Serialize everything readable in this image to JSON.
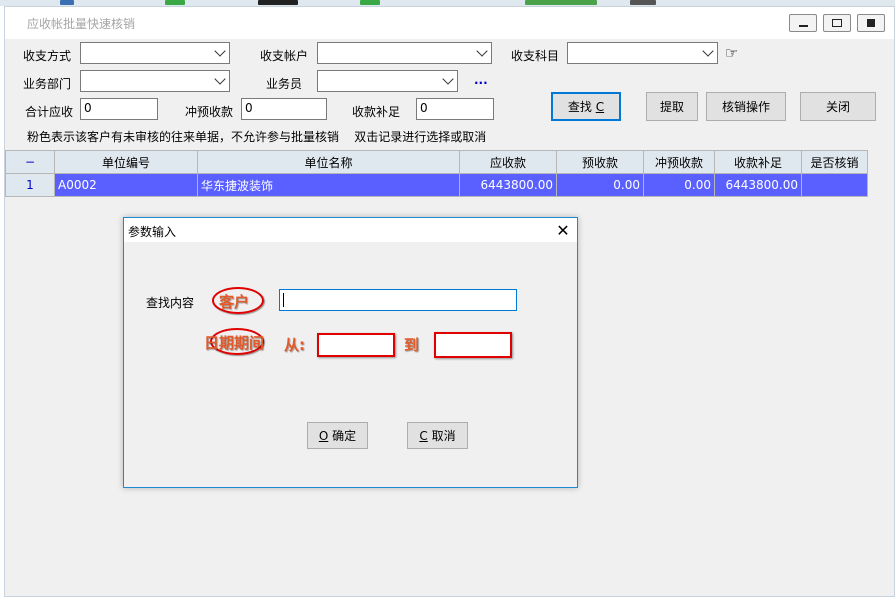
{
  "main_window": {
    "title": "应收帐批量快速核销",
    "filters": {
      "receipt_method_label": "收支方式",
      "receipt_account_label": "收支帐户",
      "receipt_subject_label": "收支科目",
      "department_label": "业务部门",
      "salesperson_label": "业务员",
      "ellipsis": "...",
      "pointer_glyph": "☞"
    },
    "totals": {
      "total_receivable_label": "合计应收",
      "total_receivable_value": "0",
      "offset_prepaid_label": "冲预收款",
      "offset_prepaid_value": "0",
      "receipt_supplement_label": "收款补足",
      "receipt_supplement_value": "0"
    },
    "buttons": {
      "find_label": "查找",
      "find_hotkey": "C",
      "extract_label": "提取",
      "writeoff_label": "核销操作",
      "close_label": "关闭"
    },
    "hint": "粉色表示该客户有未审核的往来单据，不允许参与批量核销    双击记录进行选择或取消",
    "grid": {
      "corner": "−",
      "columns": [
        "单位编号",
        "单位名称",
        "应收款",
        "预收款",
        "冲预收款",
        "收款补足",
        "是否核销"
      ],
      "rows": [
        {
          "index": "1",
          "code": "A0002",
          "name": "华东捷波装饰",
          "receivable": "6443800.00",
          "prepaid": "0.00",
          "offset_prepaid": "0.00",
          "supplement": "6443800.00",
          "writeoff": ""
        }
      ]
    }
  },
  "dialog": {
    "title": "参数输入",
    "close_glyph": "✕",
    "search_label": "查找内容",
    "search_value": "",
    "ok_hotkey": "O",
    "ok_label": "确定",
    "cancel_hotkey": "C",
    "cancel_label": "取消",
    "annotations": {
      "customer": "客户",
      "date_range": "日期期间",
      "from": "从:",
      "to": "到"
    }
  },
  "colors": {
    "selection": "#5a60ff",
    "annotation_red": "#e00000",
    "annotation_text": "#e05a2a",
    "accent_blue": "#0078d7"
  }
}
